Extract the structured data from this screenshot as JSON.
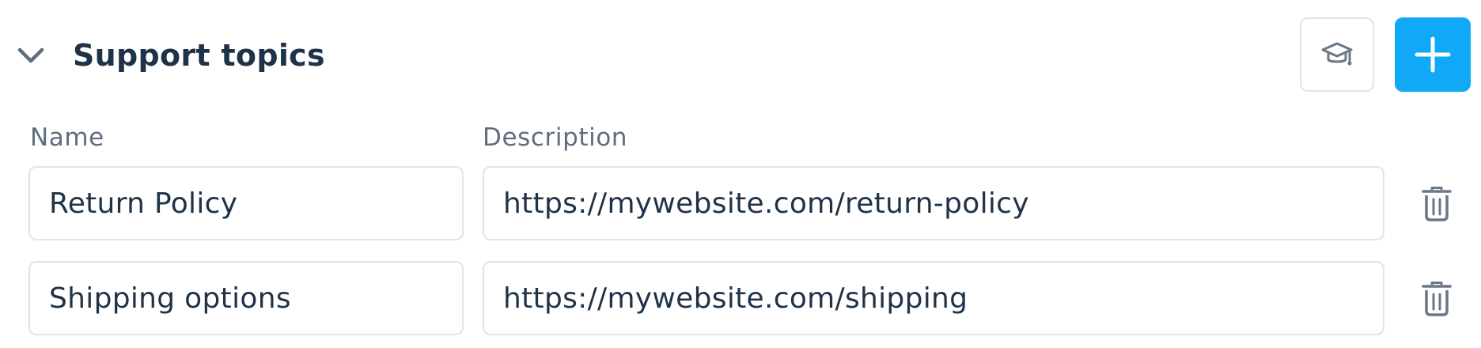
{
  "section": {
    "title": "Support topics",
    "collapse_icon": "chevron-down-icon",
    "help_icon": "graduation-cap-icon",
    "add_icon": "plus-icon"
  },
  "columns": {
    "name": "Name",
    "description": "Description"
  },
  "topics": [
    {
      "name": "Return Policy",
      "description": "https://mywebsite.com/return-policy",
      "delete_icon": "trash-icon"
    },
    {
      "name": "Shipping options",
      "description": "https://mywebsite.com/shipping",
      "delete_icon": "trash-icon"
    }
  ],
  "colors": {
    "accent": "#10a9f7",
    "title": "#1f3348",
    "label": "#5e6e80",
    "border": "#e0e4ea",
    "icon": "#6b7785"
  }
}
